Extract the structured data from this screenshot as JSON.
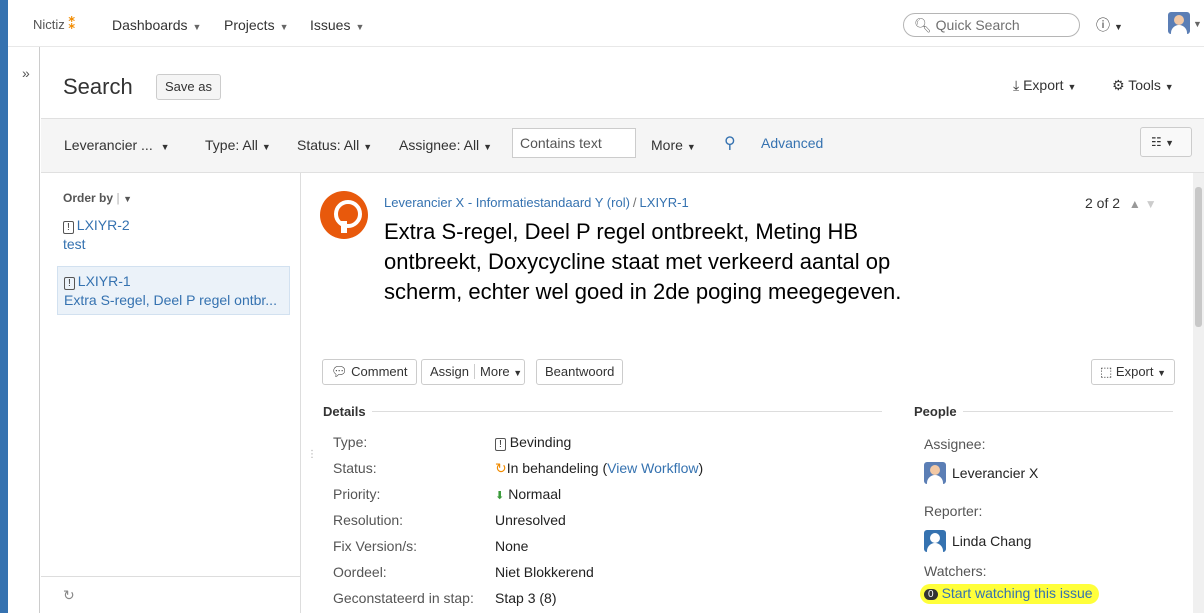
{
  "header": {
    "logo_text": "Nictiz",
    "nav": [
      "Dashboards",
      "Projects",
      "Issues"
    ],
    "quick_search_placeholder": "Quick Search",
    "help_icon": "help-icon"
  },
  "search": {
    "title": "Search",
    "save_as": "Save as",
    "export": "Export",
    "tools": "Tools"
  },
  "filters": {
    "project": "Leverancier ...",
    "type": "Type: All",
    "status": "Status: All",
    "assignee": "Assignee: All",
    "contains_placeholder": "Contains text",
    "more": "More",
    "advanced": "Advanced"
  },
  "list": {
    "order_by": "Order by",
    "items": [
      {
        "key": "LXIYR-2",
        "summary": "test"
      },
      {
        "key": "LXIYR-1",
        "summary": "Extra S-regel, Deel P regel ontbr..."
      }
    ]
  },
  "issue": {
    "project_link": "Leverancier X - Informatiestandaard Y (rol)",
    "key": "LXIYR-1",
    "pager": "2 of 2",
    "title": "Extra S-regel, Deel P regel ontbreekt, Meting HB ontbreekt, Doxycycline staat met verkeerd aantal op scherm, echter wel goed in 2de poging meegegeven.",
    "actions": {
      "comment": "Comment",
      "assign": "Assign",
      "more": "More",
      "beantwoord": "Beantwoord",
      "export": "Export"
    }
  },
  "details": {
    "heading": "Details",
    "fields": [
      {
        "label": "Type:",
        "value": "Bevinding"
      },
      {
        "label": "Status:",
        "value": "In behandeling"
      },
      {
        "label": "Priority:",
        "value": "Normaal"
      },
      {
        "label": "Resolution:",
        "value": "Unresolved"
      },
      {
        "label": "Fix Version/s:",
        "value": "None"
      },
      {
        "label": "Oordeel:",
        "value": "Niet Blokkerend"
      },
      {
        "label": "Geconstateerd in stap:",
        "value": "Stap 3 (8)"
      }
    ],
    "view_workflow": "View Workflow"
  },
  "people": {
    "heading": "People",
    "assignee_label": "Assignee:",
    "assignee": "Leverancier X",
    "reporter_label": "Reporter:",
    "reporter": "Linda Chang",
    "watchers_label": "Watchers:",
    "watch_count": "0",
    "watch_text": "Start watching this issue",
    "highlight_color": "#ffff3a"
  }
}
